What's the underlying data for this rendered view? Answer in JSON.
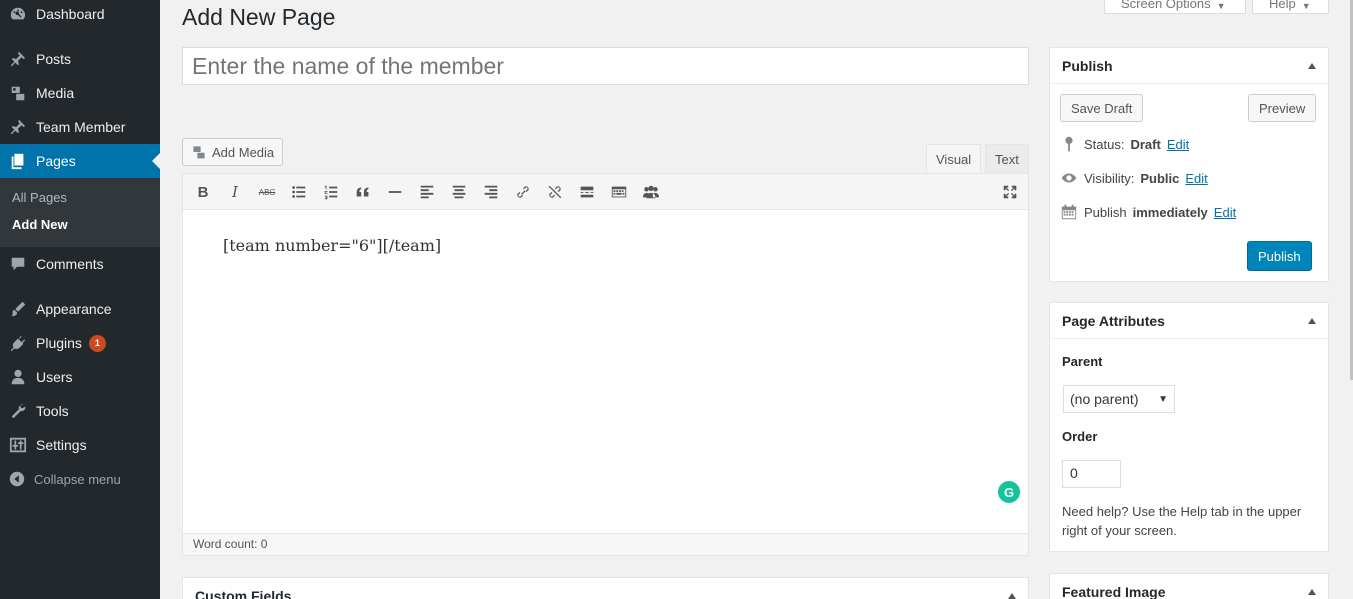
{
  "sidebar": {
    "items": [
      {
        "label": "Dashboard",
        "icon": "dashboard-icon"
      },
      {
        "label": "Posts",
        "icon": "pin-icon"
      },
      {
        "label": "Media",
        "icon": "media-icon"
      },
      {
        "label": "Team Member",
        "icon": "pin-icon"
      },
      {
        "label": "Pages",
        "icon": "pages-icon",
        "active": true
      },
      {
        "label": "Comments",
        "icon": "comments-icon"
      },
      {
        "label": "Appearance",
        "icon": "appearance-icon"
      },
      {
        "label": "Plugins",
        "icon": "plugins-icon",
        "badge": "1"
      },
      {
        "label": "Users",
        "icon": "users-icon"
      },
      {
        "label": "Tools",
        "icon": "tools-icon"
      },
      {
        "label": "Settings",
        "icon": "settings-icon"
      }
    ],
    "submenu": [
      "All Pages",
      "Add New"
    ],
    "collapse": "Collapse menu"
  },
  "header": {
    "title": "Add New Page",
    "screen_options": "Screen Options",
    "help": "Help"
  },
  "title_field": {
    "placeholder": "Enter the name of the member"
  },
  "editor": {
    "add_media": "Add Media",
    "tab_visual": "Visual",
    "tab_text": "Text",
    "content": "[team number=\"6\"][/team]",
    "word_count": "Word count: 0",
    "toolbar": [
      "B",
      "I",
      "ABC",
      "bullet-list-icon",
      "numbered-list-icon",
      "quote-icon",
      "horizontal-rule-icon",
      "align-left-icon",
      "align-center-icon",
      "align-right-icon",
      "link-icon",
      "unlink-icon",
      "read-more-icon",
      "toolbar-toggle-icon",
      "team-icon",
      "fullscreen-icon"
    ]
  },
  "custom_fields": {
    "title": "Custom Fields"
  },
  "publish": {
    "title": "Publish",
    "save_draft": "Save Draft",
    "preview": "Preview",
    "status_label": "Status:",
    "status_value": "Draft",
    "visibility_label": "Visibility:",
    "visibility_value": "Public",
    "publish_label": "Publish",
    "publish_value": "immediately",
    "edit": "Edit",
    "publish_button": "Publish"
  },
  "page_attributes": {
    "title": "Page Attributes",
    "parent_label": "Parent",
    "parent_value": "(no parent)",
    "order_label": "Order",
    "order_value": "0",
    "help": "Need help? Use the Help tab in the upper right of your screen."
  },
  "featured_image": {
    "title": "Featured Image"
  },
  "colors": {
    "sidebar": "#23282d",
    "active": "#0073aa",
    "primary_button": "#0085ba",
    "badge": "#ca4a1f"
  }
}
